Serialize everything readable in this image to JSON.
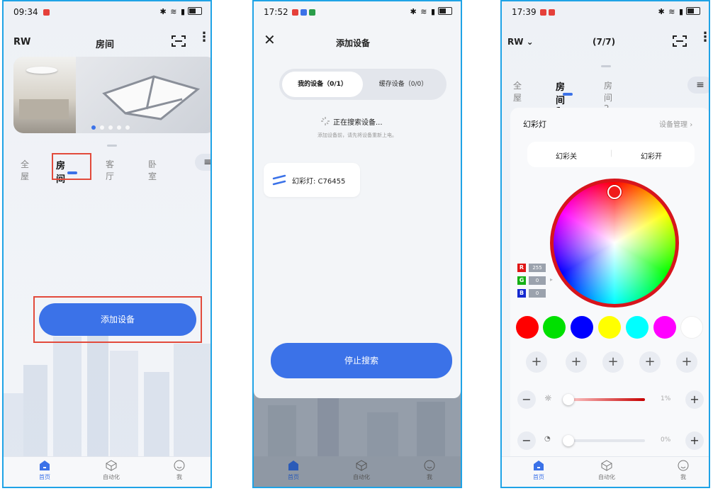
{
  "phone1": {
    "time": "09:34",
    "title": "房间",
    "left_label": "RW",
    "tabs": [
      "全屋",
      "房间",
      "客厅",
      "卧室"
    ],
    "add_device": "添加设备",
    "nav": [
      "首页",
      "自动化",
      "我"
    ]
  },
  "phone2": {
    "time": "17:52",
    "title": "添加设备",
    "seg_on": "我的设备（0/1）",
    "seg_off": "缓存设备（0/0）",
    "searching": "正在搜索设备...",
    "hint": "添加设备前，请先将设备重新上电。",
    "device": "幻彩灯: C76455",
    "stop": "停止搜索",
    "nav": [
      "首页",
      "自动化",
      "我"
    ]
  },
  "phone3": {
    "time": "17:39",
    "left_label": "RW",
    "count": "(7/7)",
    "tabs": [
      "全屋",
      "房间1",
      "房间2"
    ],
    "device_title": "幻彩灯",
    "manage": "设备管理",
    "seg_off": "幻彩关",
    "seg_on": "幻彩开",
    "r_label": "R",
    "g_label": "G",
    "b_label": "B",
    "r": "255",
    "g": "0",
    "b": "0",
    "brightness": "1%",
    "speed": "0%",
    "nav": [
      "首页",
      "自动化",
      "我"
    ]
  },
  "colors": {
    "accent": "#3b72e8",
    "highlight": "#e24a3b",
    "swatches": [
      "#ff0000",
      "#00e000",
      "#0000ff",
      "#ffff00",
      "#00ffff",
      "#ff00ff",
      "#ffffff"
    ]
  }
}
